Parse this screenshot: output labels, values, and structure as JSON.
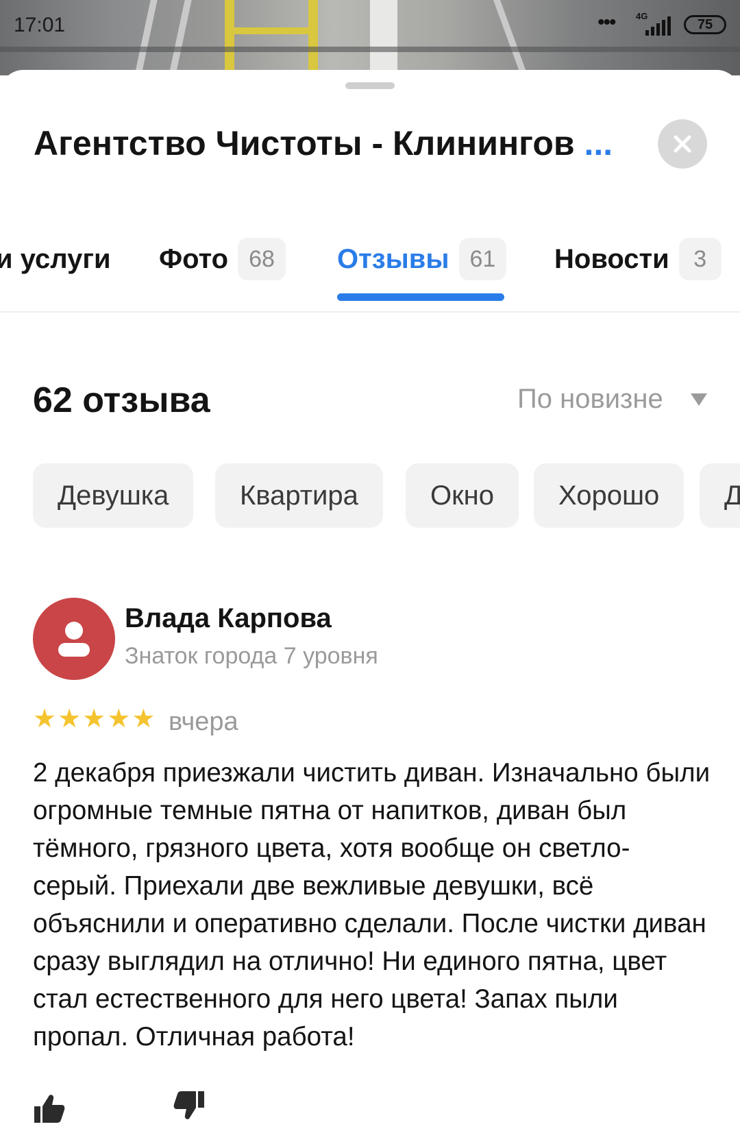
{
  "status_bar": {
    "time": "17:01",
    "network": "4G",
    "battery": "75"
  },
  "header": {
    "title": "Агентство Чистоты - Клинингов",
    "title_more": "..."
  },
  "tabs": [
    {
      "label": "и услуги",
      "count": ""
    },
    {
      "label": "Фото",
      "count": "68"
    },
    {
      "label": "Отзывы",
      "count": "61",
      "active": true
    },
    {
      "label": "Новости",
      "count": "3"
    }
  ],
  "reviews": {
    "count_label": "62 отзыва",
    "sort_label": "По новизне"
  },
  "chips": [
    "Девушка",
    "Квартира",
    "Окно",
    "Хорошо",
    "Д"
  ],
  "review": {
    "author_name": "Влада Карпова",
    "author_level": "Знаток города 7 уровня",
    "rating": 5,
    "date": "вчера",
    "text": "2 декабря приезжали чистить диван. Изначально были огромные темные пятна от напитков, диван был тёмного, грязного цвета, хотя вообще он светло-серый. Приехали две вежливые девушки, всё объяснили и оперативно сделали. После чистки диван сразу выглядил на отлично! Ни единого пятна, цвет стал естественного для него цвета! Запах пыли пропал. Отличная работа!"
  },
  "colors": {
    "accent": "#2a7de8",
    "avatar": "#c94547",
    "star": "#f4c430"
  }
}
